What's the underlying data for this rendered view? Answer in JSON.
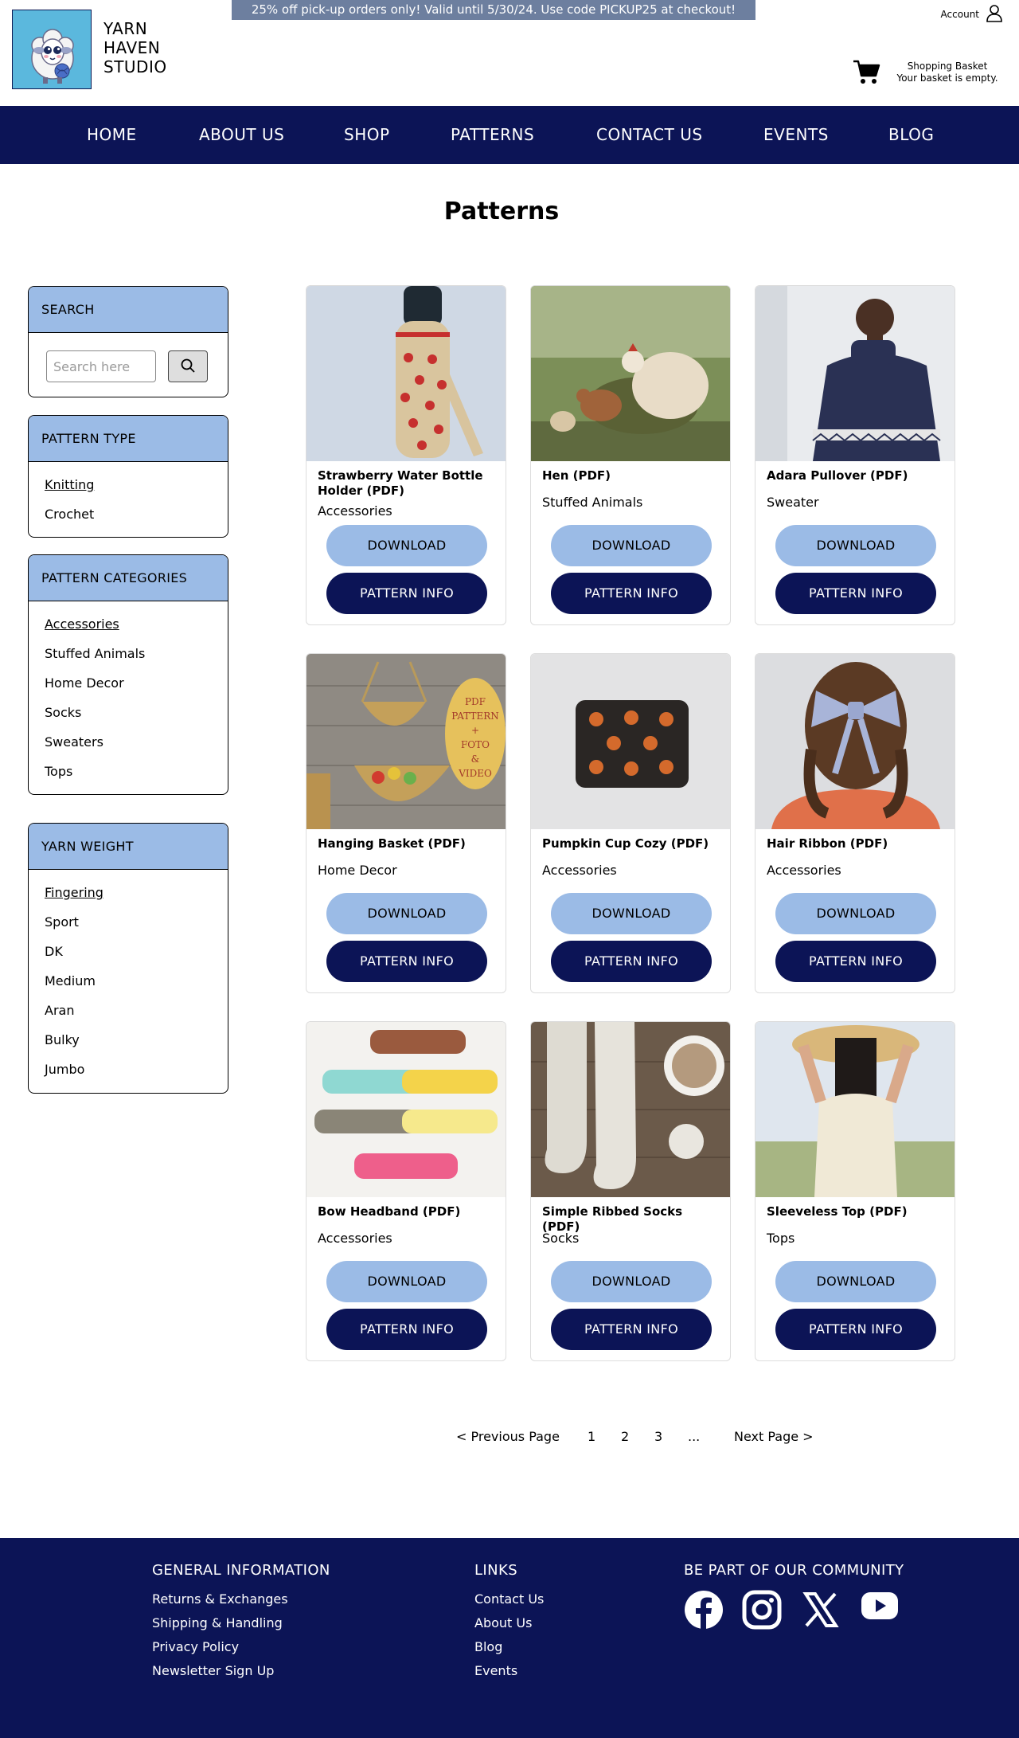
{
  "promo_banner": "25% off pick-up orders only! Valid until 5/30/24. Use code PICKUP25 at checkout!",
  "brand": {
    "line1": "YARN",
    "line2": "HAVEN",
    "line3": "STUDIO"
  },
  "account": {
    "label": "Account"
  },
  "basket": {
    "title": "Shopping Basket",
    "status": "Your basket is empty."
  },
  "nav": [
    "HOME",
    "ABOUT US",
    "SHOP",
    "PATTERNS",
    "CONTACT US",
    "EVENTS",
    "BLOG"
  ],
  "page_title": "Patterns",
  "sidebar": {
    "search": {
      "title": "SEARCH",
      "placeholder": "Search here"
    },
    "pattern_type": {
      "title": "PATTERN TYPE",
      "items": [
        "Knitting",
        "Crochet"
      ]
    },
    "pattern_categories": {
      "title": "PATTERN CATEGORIES",
      "items": [
        "Accessories",
        "Stuffed Animals",
        "Home Decor",
        "Socks",
        "Sweaters",
        "Tops"
      ]
    },
    "yarn_weight": {
      "title": "YARN WEIGHT",
      "items": [
        "Fingering",
        "Sport",
        "DK",
        "Medium",
        "Aran",
        "Bulky",
        "Jumbo"
      ]
    }
  },
  "products": [
    {
      "name": "Strawberry Water Bottle Holder (PDF)",
      "category": "Accessories",
      "download": "DOWNLOAD",
      "info": "PATTERN INFO"
    },
    {
      "name": "Hen (PDF)",
      "category": "Stuffed Animals",
      "download": "DOWNLOAD",
      "info": "PATTERN INFO"
    },
    {
      "name": "Adara Pullover (PDF)",
      "category": "Sweater",
      "download": "DOWNLOAD",
      "info": "PATTERN INFO"
    },
    {
      "name": "Hanging Basket (PDF)",
      "category": "Home Decor",
      "download": "DOWNLOAD",
      "info": "PATTERN INFO",
      "image_text": [
        "PDF",
        "PATTERN",
        "+",
        "FOTO",
        "&",
        "VIDEO"
      ]
    },
    {
      "name": "Pumpkin Cup Cozy (PDF)",
      "category": "Accessories",
      "download": "DOWNLOAD",
      "info": "PATTERN INFO"
    },
    {
      "name": "Hair Ribbon (PDF)",
      "category": "Accessories",
      "download": "DOWNLOAD",
      "info": "PATTERN INFO"
    },
    {
      "name": "Bow Headband (PDF)",
      "category": "Accessories",
      "download": "DOWNLOAD",
      "info": "PATTERN INFO"
    },
    {
      "name": "Simple Ribbed Socks (PDF)",
      "category": "Socks",
      "download": "DOWNLOAD",
      "info": "PATTERN INFO"
    },
    {
      "name": "Sleeveless Top (PDF)",
      "category": "Tops",
      "download": "DOWNLOAD",
      "info": "PATTERN INFO"
    }
  ],
  "pagination": {
    "prev": "< Previous Page",
    "pages": [
      "1",
      "2",
      "3",
      "..."
    ],
    "next": "Next Page >"
  },
  "footer": {
    "general": {
      "title": "GENERAL INFORMATION",
      "links": [
        "Returns & Exchanges",
        "Shipping & Handling",
        "Privacy Policy",
        "Newsletter Sign Up"
      ]
    },
    "links": {
      "title": "LINKS",
      "links": [
        "Contact Us",
        "About Us",
        "Blog",
        "Events"
      ]
    },
    "community": {
      "title": "BE PART OF OUR COMMUNITY",
      "icons": [
        "facebook-icon",
        "instagram-icon",
        "x-icon",
        "youtube-icon"
      ]
    }
  },
  "colors": {
    "navy": "#0c1456",
    "light_blue": "#9bbbe6",
    "promo_gray": "#6d7f9f",
    "logo_blue": "#5bb8dd"
  }
}
